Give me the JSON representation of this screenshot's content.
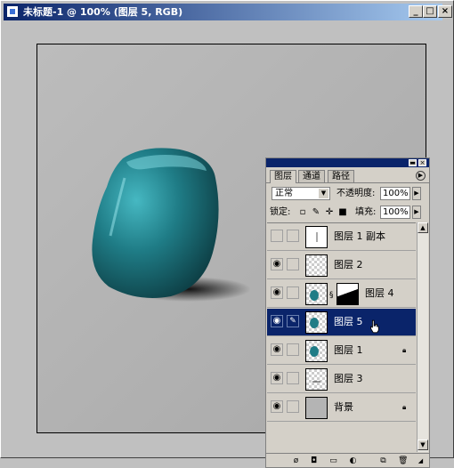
{
  "window": {
    "title": "未标题-1 @ 100% (图层 5, RGB)",
    "minimize": "_",
    "maximize": "□",
    "close": "×"
  },
  "layers_palette": {
    "tabs": [
      "图层",
      "通道",
      "路径"
    ],
    "blend_mode": "正常",
    "opacity_label": "不透明度:",
    "opacity_value": "100%",
    "lock_label": "锁定:",
    "fill_label": "填充:",
    "fill_value": "100%",
    "layers": [
      {
        "name": "图层 1 副本",
        "visible": false,
        "selected": false,
        "locked": false
      },
      {
        "name": "图层 2",
        "visible": true,
        "selected": false,
        "locked": false
      },
      {
        "name": "图层 4",
        "visible": true,
        "selected": false,
        "locked": false
      },
      {
        "name": "图层 5",
        "visible": true,
        "selected": true,
        "locked": false
      },
      {
        "name": "图层 1",
        "visible": true,
        "selected": false,
        "locked": true
      },
      {
        "name": "图层 3",
        "visible": true,
        "selected": false,
        "locked": false
      },
      {
        "name": "背景",
        "visible": true,
        "selected": false,
        "locked": true
      }
    ]
  },
  "colors": {
    "titlebar": "#0a246a",
    "selected_layer": "#0a246a",
    "vase": "#1f7c86",
    "canvas_bg": "#b4b4b4"
  }
}
